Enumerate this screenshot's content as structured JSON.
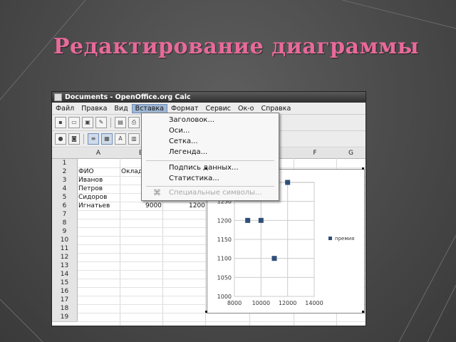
{
  "slide": {
    "title": "Редактирование диаграммы"
  },
  "window": {
    "title": "Documents - OpenOffice.org Calc"
  },
  "menubar": {
    "items": [
      "Файл",
      "Правка",
      "Вид",
      "Вставка",
      "Формат",
      "Сервис",
      "Ок-о",
      "Справка"
    ],
    "active_index": 3
  },
  "insert_menu": {
    "items": [
      "Заголовок...",
      "Оси...",
      "Сетка...",
      "Легенда..."
    ],
    "items2": [
      "Подпись данных...",
      "Статистика..."
    ],
    "items3": [
      "Специальные символы..."
    ]
  },
  "sheet": {
    "columns": [
      "A",
      "B",
      "",
      "",
      "",
      "F",
      "G"
    ],
    "row_numbers": [
      "1",
      "2",
      "3",
      "4",
      "5",
      "6",
      "7",
      "8",
      "9",
      "10",
      "11",
      "12",
      "13",
      "14",
      "15",
      "16",
      "17",
      "18",
      "19"
    ],
    "cells": {
      "A2": "ФИО",
      "B2": "Оклад",
      "A3": "Иванов",
      "A4": "Петров",
      "A5": "Сидоров",
      "A6": "Игнатьев",
      "B6": "9000",
      "C6": "1200"
    }
  },
  "chart_data": {
    "type": "scatter",
    "title": "",
    "xlabel": "",
    "ylabel": "",
    "x_ticks": [
      "8000",
      "10000",
      "12000",
      "14000"
    ],
    "y_ticks": [
      "1000",
      "1050",
      "1100",
      "1150",
      "1200",
      "1250"
    ],
    "xlim": [
      8000,
      14000
    ],
    "ylim": [
      1000,
      1300
    ],
    "series": [
      {
        "name": "премия",
        "points": [
          [
            9000,
            1200
          ],
          [
            10000,
            1200
          ],
          [
            11000,
            1100
          ],
          [
            12000,
            1300
          ]
        ]
      }
    ],
    "legend": "right",
    "grid": true,
    "colors": {
      "marker": "#2f4f7a"
    }
  }
}
